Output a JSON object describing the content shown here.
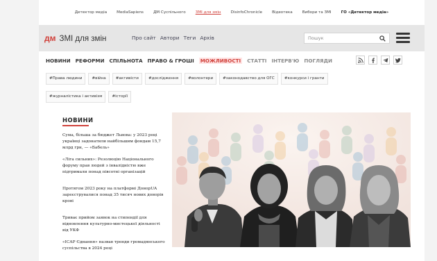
{
  "topbar": {
    "links": [
      "Детектор медіа",
      "MediaSapiens",
      "ДМ Суспільного",
      "ЗМІ для змін",
      "DisinfoChronicle",
      "Відеотека",
      "Вибори та ЗМІ",
      "ГО «Детектор медіа»"
    ]
  },
  "header": {
    "logo_mark": "дм",
    "logo_text": "ЗМІ для змін",
    "nav": [
      "Про сайт",
      "Автори",
      "Теги",
      "Архів"
    ]
  },
  "search": {
    "placeholder": "Пошук"
  },
  "categories": [
    "НОВИНИ",
    "РЕФОРМИ",
    "СПІЛЬНОТА",
    "ПРАВО & ГРОШІ",
    "МОЖЛИВОСТІ",
    "СТАТТІ",
    "ІНТЕРВ'Ю",
    "ПОГЛЯДИ"
  ],
  "social_icons": [
    "rss-icon",
    "facebook-icon",
    "telegram-icon",
    "twitter-icon"
  ],
  "tags_row1": [
    "#Права людини",
    "#війна",
    "#активісти",
    "#дослідження",
    "#волонтери",
    "#законодавство для ОГС",
    "#конкурси і гранти"
  ],
  "tags_row2": [
    "#журналістика і активізм",
    "#історії"
  ],
  "news": {
    "heading": "НОВИНИ",
    "items": [
      "Сума, більша за бюджет Львова: у 2023 році українці задонатили найбільшим фондам 15,7 млрд грн, — «Бабель»",
      "«Ліга сильних»: Резолюцію Національного форуму прав людей з інвалідністю вже підтримали понад пів​сотні організацій",
      "Протягом 2023 року на платформі ДонорUA зареєструвалися понад 35 тисяч нових донорів крові",
      "Триває прийом заявок на стипендії для відновлення культурно-мистецької діяльності від УКФ",
      "«ІСАР Єднання» назвав тренди громадянського суспільства в 2024 році"
    ]
  },
  "colors": {
    "accent": "#d0403a",
    "header_bg": "#e6e6e6",
    "page_bg": "#ffffff",
    "outer_bg": "#f3f3f3"
  }
}
